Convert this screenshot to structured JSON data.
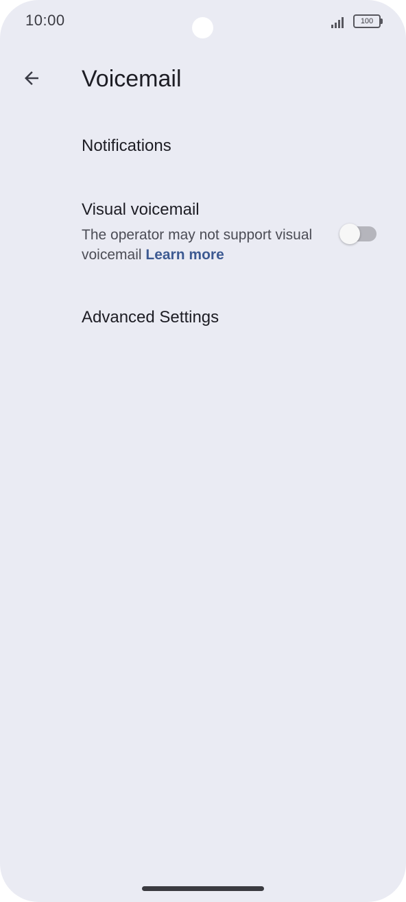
{
  "status_bar": {
    "time": "10:00",
    "signal_icon": "signal-bars-icon",
    "battery_level": "100",
    "battery_icon": "battery-icon"
  },
  "app_bar": {
    "back_icon": "arrow-back-icon",
    "title": "Voicemail"
  },
  "settings": {
    "notifications": {
      "title": "Notifications"
    },
    "visual_voicemail": {
      "title": "Visual voicemail",
      "summary": "The operator may not support visual voicemail",
      "link": "Learn more",
      "enabled": false
    },
    "advanced": {
      "title": "Advanced Settings"
    }
  },
  "colors": {
    "background": "#eaebf3",
    "text_primary": "#1d1d24",
    "text_secondary": "#4b4c55",
    "link": "#3d5a92",
    "toggle_off_track": "#b5b5bc",
    "toggle_thumb": "#f7f7f7"
  }
}
